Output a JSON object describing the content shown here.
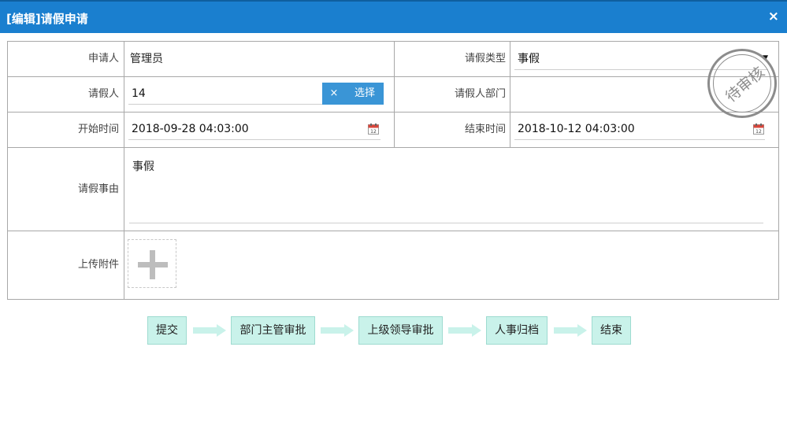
{
  "window": {
    "title": "[编辑]请假申请",
    "close_icon": "×"
  },
  "form": {
    "applicant_label": "申请人",
    "applicant_value": "管理员",
    "leave_type_label": "请假类型",
    "leave_type_value": "事假",
    "leave_person_label": "请假人",
    "leave_person_value": "14",
    "clear_button": "×",
    "select_button": "选择",
    "department_label": "请假人部门",
    "department_value": "",
    "start_time_label": "开始时间",
    "start_time_value": "2018-09-28 04:03:00",
    "end_time_label": "结束时间",
    "end_time_value": "2018-10-12 04:03:00",
    "reason_label": "请假事由",
    "reason_value": "事假",
    "attachment_label": "上传附件"
  },
  "stamp": {
    "text": "待审核",
    "color": "#8c8c8c"
  },
  "workflow": {
    "steps": [
      "提交",
      "部门主管审批",
      "上级领导审批",
      "人事归档",
      "结束"
    ],
    "step_color": "#c9f2ea",
    "arrow_color": "#c9f2ea"
  },
  "colors": {
    "titlebar": "#1a7fcf",
    "button": "#3a95d6"
  }
}
